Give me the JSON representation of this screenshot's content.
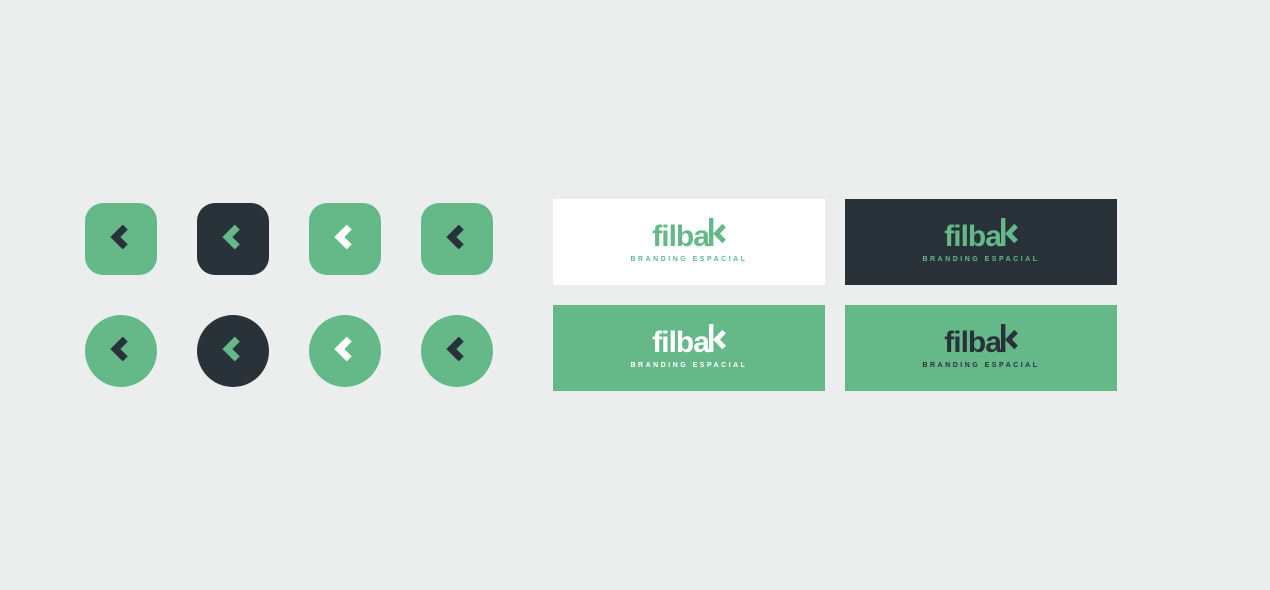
{
  "colors": {
    "green": "#65b989",
    "dark": "#283238",
    "white": "#ffffff",
    "bg": "#eceeee"
  },
  "brand": {
    "name": "filbak",
    "tagline": "BRANDING ESPACIAL"
  },
  "icon_tiles": [
    {
      "shape": "squircle",
      "bg": "green",
      "chevron": "dark"
    },
    {
      "shape": "squircle",
      "bg": "dark",
      "chevron": "green"
    },
    {
      "shape": "squircle",
      "bg": "green",
      "chevron": "white"
    },
    {
      "shape": "squircle",
      "bg": "green",
      "chevron": "dark"
    },
    {
      "shape": "circle",
      "bg": "green",
      "chevron": "dark"
    },
    {
      "shape": "circle",
      "bg": "dark",
      "chevron": "green"
    },
    {
      "shape": "circle",
      "bg": "green",
      "chevron": "white"
    },
    {
      "shape": "circle",
      "bg": "green",
      "chevron": "dark"
    }
  ],
  "logo_panels": [
    {
      "bg": "white",
      "brand_color": "green",
      "tag_color": "green"
    },
    {
      "bg": "dark",
      "brand_color": "green",
      "tag_color": "green"
    },
    {
      "bg": "green",
      "brand_color": "white",
      "tag_color": "white"
    },
    {
      "bg": "green",
      "brand_color": "dark",
      "tag_color": "dark"
    }
  ]
}
